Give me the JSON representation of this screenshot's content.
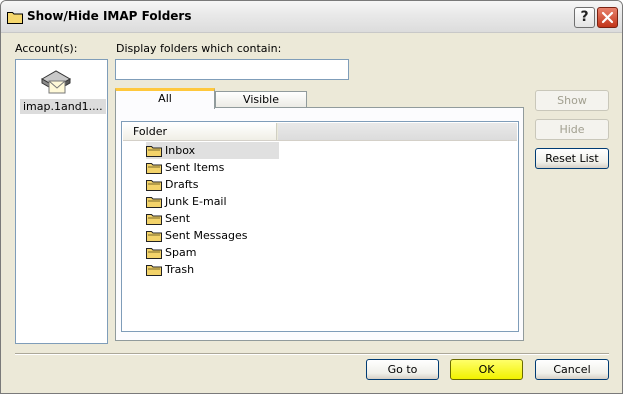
{
  "window": {
    "title": "Show/Hide IMAP Folders",
    "help_glyph": "?"
  },
  "accounts": {
    "label": "Account(s):",
    "items": [
      {
        "name": "imap.1and1....",
        "icon": "mail-server-icon"
      }
    ]
  },
  "filter": {
    "label": "Display folders which contain:",
    "value": ""
  },
  "tabs": [
    {
      "label": "All",
      "active": true
    },
    {
      "label": "Visible",
      "active": false
    }
  ],
  "folders": {
    "column_header": "Folder",
    "rows": [
      {
        "label": "Inbox",
        "selected": true
      },
      {
        "label": "Sent Items"
      },
      {
        "label": "Drafts"
      },
      {
        "label": "Junk E-mail"
      },
      {
        "label": "Sent"
      },
      {
        "label": "Sent Messages"
      },
      {
        "label": "Spam"
      },
      {
        "label": "Trash"
      }
    ]
  },
  "side_buttons": {
    "show": "Show",
    "hide": "Hide",
    "reset": "Reset List"
  },
  "footer_buttons": {
    "goto": "Go to",
    "ok": "OK",
    "cancel": "Cancel"
  },
  "colors": {
    "ok_button": "#ffff00",
    "tab_accent": "#ffc83c",
    "close_button": "#c2351a"
  }
}
